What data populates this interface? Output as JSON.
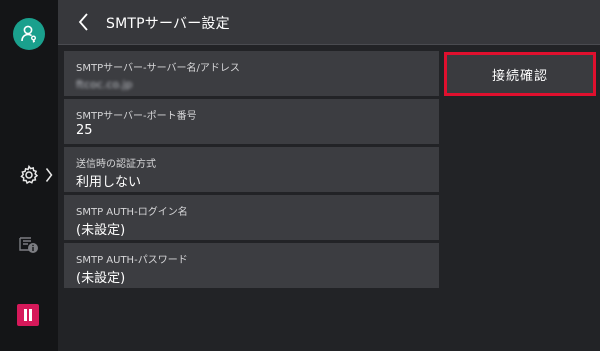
{
  "header": {
    "title": "SMTPサーバー設定",
    "back_icon": "chevron-left-icon"
  },
  "sidebar": {
    "user_icon": "user-key-icon",
    "settings_icon": "gear-icon",
    "expand_icon": "chevron-right-icon",
    "printer_icon": "printer-info-icon",
    "pause_icon": "pause-icon"
  },
  "settings": [
    {
      "label": "SMTPサーバー-サーバー名/アドレス",
      "value": "ftcoc.co.jp",
      "blurred": true
    },
    {
      "label": "SMTPサーバー-ポート番号",
      "value": "25"
    },
    {
      "label": "送信時の認証方式",
      "value": "利用しない"
    },
    {
      "label": "SMTP  AUTH-ログイン名",
      "value": "(未設定)"
    },
    {
      "label": "SMTP  AUTH-パスワード",
      "value": "(未設定)"
    }
  ],
  "actions": {
    "connect_test": "接続確認"
  },
  "colors": {
    "accent_red": "#e0102e",
    "user_teal": "#1aa08d",
    "pause_pink": "#d6195a"
  }
}
